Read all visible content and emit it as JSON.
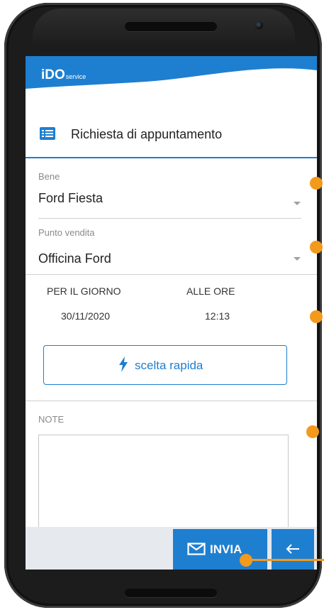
{
  "header": {
    "logo_main": "iDO",
    "logo_sub": "service"
  },
  "page": {
    "title": "Richiesta di appuntamento"
  },
  "form": {
    "bene": {
      "label": "Bene",
      "value": "Ford Fiesta"
    },
    "punto_vendita": {
      "label": "Punto vendita",
      "value": "Officina Ford"
    },
    "giorno": {
      "label": "PER IL GIORNO",
      "value": "30/11/2020"
    },
    "ore": {
      "label": "ALLE ORE",
      "value": "12:13"
    },
    "quick_pick_label": "scelta rapida",
    "note_label": "NOTE",
    "note_value": ""
  },
  "actions": {
    "send_label": "INVIA",
    "back_symbol": "←"
  },
  "colors": {
    "brand_blue": "#1e7fd0",
    "annotation_orange": "#f39a1c",
    "phone_body": "#1c1c1c"
  },
  "icons": [
    "list-icon",
    "lightning-icon",
    "mail-icon",
    "arrow-left-icon",
    "dropdown-caret-icon"
  ]
}
